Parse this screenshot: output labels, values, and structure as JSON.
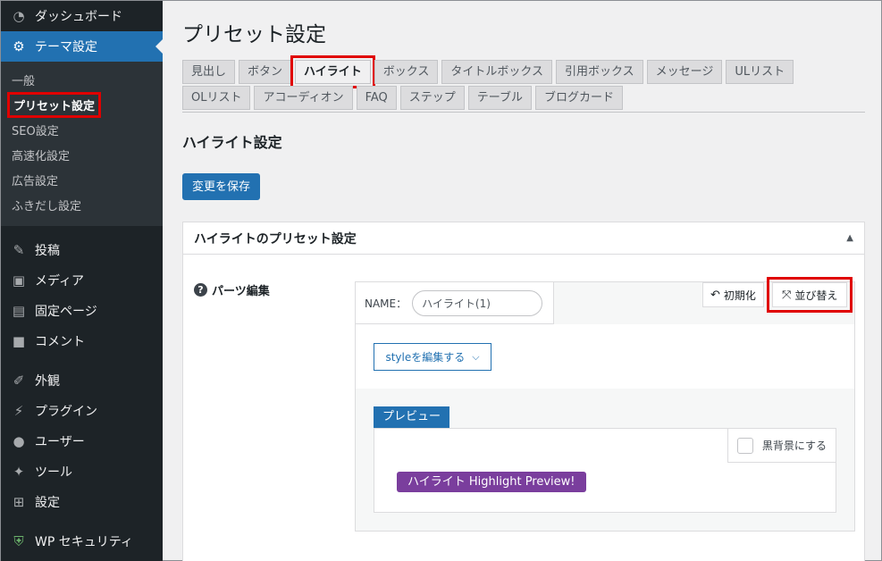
{
  "sidebar": {
    "dashboard": "ダッシュボード",
    "theme": "テーマ設定",
    "submenu": [
      "一般",
      "プリセット設定",
      "SEO設定",
      "高速化設定",
      "広告設定",
      "ふきだし設定"
    ],
    "items": [
      "投稿",
      "メディア",
      "固定ページ",
      "コメント"
    ],
    "items2": [
      "外観",
      "プラグイン",
      "ユーザー",
      "ツール",
      "設定"
    ],
    "security": "WP セキュリティ"
  },
  "page": {
    "title": "プリセット設定",
    "tabs_row1": [
      "見出し",
      "ボタン",
      "ハイライト",
      "ボックス",
      "タイトルボックス",
      "引用ボックス",
      "メッセージ",
      "ULリスト",
      "OLリスト"
    ],
    "tabs_row2": [
      "アコーディオン",
      "FAQ",
      "ステップ",
      "テーブル",
      "ブログカード"
    ],
    "section_heading": "ハイライト設定",
    "save_label": "変更を保存"
  },
  "panel": {
    "title": "ハイライトのプリセット設定",
    "toggle": "▲",
    "field_label": "パーツ編集",
    "help": "?",
    "name_label": "NAME：",
    "name_value": "ハイライト(1)",
    "init_label": "初期化",
    "sort_label": "並び替え",
    "style_label": "styleを編集する",
    "preview_tab": "プレビュー",
    "dark_label": "黒背景にする",
    "sample_text": "ハイライト Highlight Preview!"
  },
  "colors": {
    "accent": "#2271b1",
    "sidebar_bg": "#1d2327",
    "highlight": "#7a3e9d",
    "annotation": "#e00000"
  }
}
